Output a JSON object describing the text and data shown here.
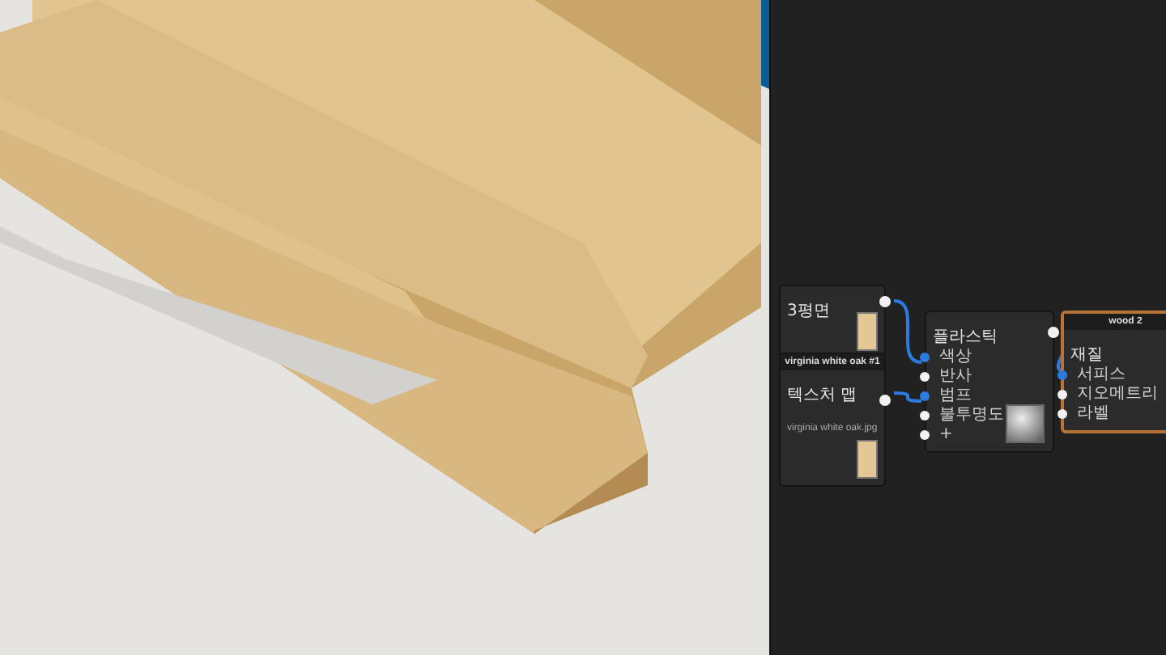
{
  "node_editor": {
    "nodes": [
      {
        "kind": "swatch",
        "title": "3평면"
      },
      {
        "kind": "texture",
        "header": "virginia white oak #1",
        "title": "텍스처 맵",
        "file": "virginia white oak.jpg"
      },
      {
        "kind": "material",
        "title": "플라스틱",
        "inputs": [
          {
            "label": "색상",
            "connected": true
          },
          {
            "label": "반사",
            "connected": false
          },
          {
            "label": "범프",
            "connected": true
          },
          {
            "label": "불투명도",
            "connected": false
          },
          {
            "label": "+",
            "connected": false
          }
        ]
      },
      {
        "kind": "output",
        "header": "wood 2",
        "title": "재질",
        "selected": true,
        "inputs": [
          {
            "label": "서피스",
            "connected": true
          },
          {
            "label": "지오메트리",
            "connected": false
          },
          {
            "label": "라벨",
            "connected": false
          }
        ]
      }
    ]
  }
}
